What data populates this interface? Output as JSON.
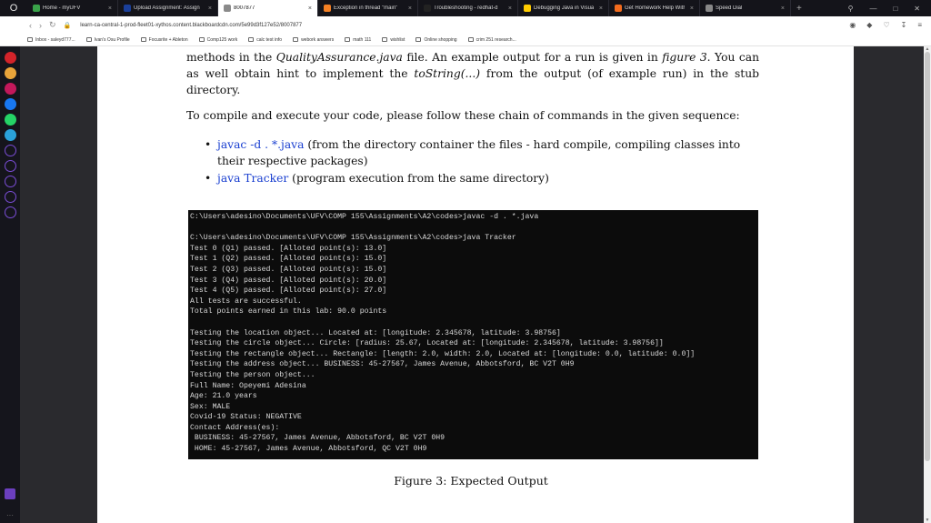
{
  "browser": {
    "tabs": [
      {
        "label": "Home - myUFV",
        "color": "#3aa34a",
        "active": false
      },
      {
        "label": "Upload Assignment: Assign",
        "color": "#1a3f9a",
        "active": false
      },
      {
        "label": "8007877",
        "color": "#8a8a8a",
        "active": true
      },
      {
        "label": "Exception in thread \"main\"",
        "color": "#f48024",
        "active": false
      },
      {
        "label": "Troubleshooting - redhat-d",
        "color": "#222222",
        "active": false
      },
      {
        "label": "Debugging Java in Visual S",
        "color": "#ffcc00",
        "active": false
      },
      {
        "label": "Get Homework Help With",
        "color": "#f26b1d",
        "active": false
      },
      {
        "label": "Speed Dial",
        "color": "#888888",
        "active": false
      }
    ],
    "url": "learn-ca-central-1-prod-fleet01-xythos.content.blackboardcdn.com/5e99d3f127e52/8007877",
    "bookmarks": [
      "Inbox - saleyd777...",
      "Ivan's Osu Profile",
      "Focusrite + Ableton",
      "Comp125 work",
      "calc test info",
      "webork answers",
      "math 111",
      "wishlist",
      "Online shopping",
      "crim 251 research..."
    ]
  },
  "doc": {
    "para1_prefix": "methods in the ",
    "para1_class": "QualityAssurance.java",
    "para1_mid": " file.  An example output for a run is given in ",
    "para1_fig": "figure 3",
    "para1_mid2": ".  You can as well obtain hint to implement the ",
    "para1_method": "toString(...)",
    "para1_suffix": " from the output (of example run) in the stub directory.",
    "para2": "To compile and execute your code, please follow these chain of commands in the given sequence:",
    "bullets": [
      {
        "cmd": "javac -d . *.java",
        "desc": " (from the directory container the files - hard compile, compiling classes into their respective packages)"
      },
      {
        "cmd": "java Tracker",
        "desc": " (program execution from the same directory)"
      }
    ],
    "caption": "Figure 3: Expected Output"
  },
  "terminal_lines": [
    "C:\\Users\\adesino\\Documents\\UFV\\COMP 155\\Assignments\\A2\\codes>javac -d . *.java",
    "",
    "C:\\Users\\adesino\\Documents\\UFV\\COMP 155\\Assignments\\A2\\codes>java Tracker",
    "Test 0 (Q1) passed. [Alloted point(s): 13.0]",
    "Test 1 (Q2) passed. [Alloted point(s): 15.0]",
    "Test 2 (Q3) passed. [Alloted point(s): 15.0]",
    "Test 3 (Q4) passed. [Alloted point(s): 20.0]",
    "Test 4 (Q5) passed. [Alloted point(s): 27.0]",
    "All tests are successful.",
    "Total points earned in this lab: 90.0 points",
    "",
    "Testing the location object... Located at: [longitude: 2.345678, latitude: 3.98756]",
    "Testing the circle object... Circle: [radius: 25.67, Located at: [longitude: 2.345678, latitude: 3.98756]]",
    "Testing the rectangle object... Rectangle: [length: 2.0, width: 2.0, Located at: [longitude: 0.0, latitude: 0.0]]",
    "Testing the address object... BUSINESS: 45-27567, James Avenue, Abbotsford, BC V2T 0H9",
    "Testing the person object...",
    "Full Name: Opeyemi Adesina",
    "Age: 21.0 years",
    "Sex: MALE",
    "Covid-19 Status: NEGATIVE",
    "Contact Address(es):",
    " BUSINESS: 45-27567, James Avenue, Abbotsford, BC V2T 0H9",
    " HOME: 45-27567, James Avenue, Abbotsford, QC V2T 0H9"
  ],
  "sidebar_icons": [
    {
      "name": "opera-o-icon",
      "color": "#d2232a"
    },
    {
      "name": "shopping-bag-icon",
      "color": "#e8a33a"
    },
    {
      "name": "chat-bubble-icon",
      "color": "#c2185b"
    },
    {
      "name": "messenger-icon",
      "color": "#1877f2"
    },
    {
      "name": "whatsapp-icon",
      "color": "#25d366"
    },
    {
      "name": "telegram-icon",
      "color": "#2aa1da"
    },
    {
      "name": "player-icon",
      "color": "#7a4dd6"
    },
    {
      "name": "send-icon",
      "color": "#7a4dd6"
    },
    {
      "name": "history-icon",
      "color": "#7a4dd6"
    },
    {
      "name": "box-icon",
      "color": "#7a4dd6"
    },
    {
      "name": "gear-icon",
      "color": "#7a4dd6"
    }
  ]
}
